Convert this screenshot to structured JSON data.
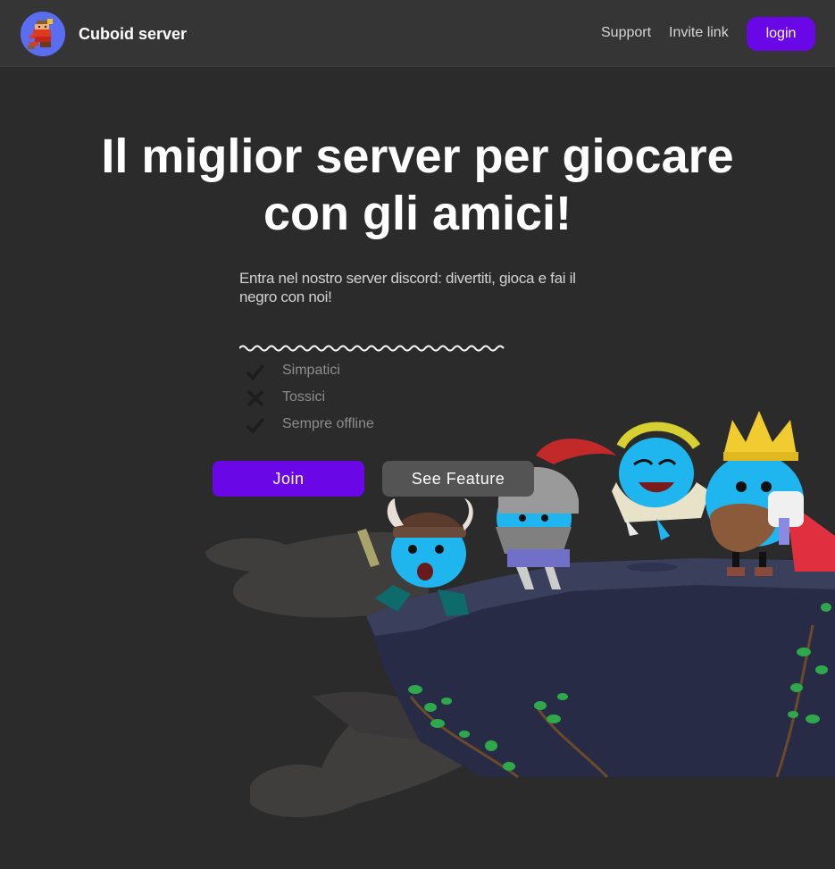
{
  "navbar": {
    "brand": "Cuboid server",
    "links": [
      {
        "label": "Support"
      },
      {
        "label": "Invite link"
      }
    ],
    "login_label": "login",
    "avatar_icon": "pixel-character-avatar"
  },
  "hero": {
    "title_line1": "Il miglior server per giocare",
    "title_line2": "con gli amici!",
    "subtitle": "Entra nel nostro server discord: divertiti, gioca e fai il negro con noi!",
    "features": [
      {
        "label": "Simpatici",
        "icon": "check-icon"
      },
      {
        "label": "Tossici",
        "icon": "x-icon"
      },
      {
        "label": "Sempre offline",
        "icon": "check-icon"
      }
    ],
    "join_label": "Join",
    "see_feature_label": "See Feature",
    "illustration": "cartoon-characters-on-cliff"
  },
  "colors": {
    "background": "#2b2b2b",
    "navbar": "#353535",
    "accent": "#6a07e6",
    "secondary_button": "#545454",
    "character_blue": "#1fb6f0"
  }
}
